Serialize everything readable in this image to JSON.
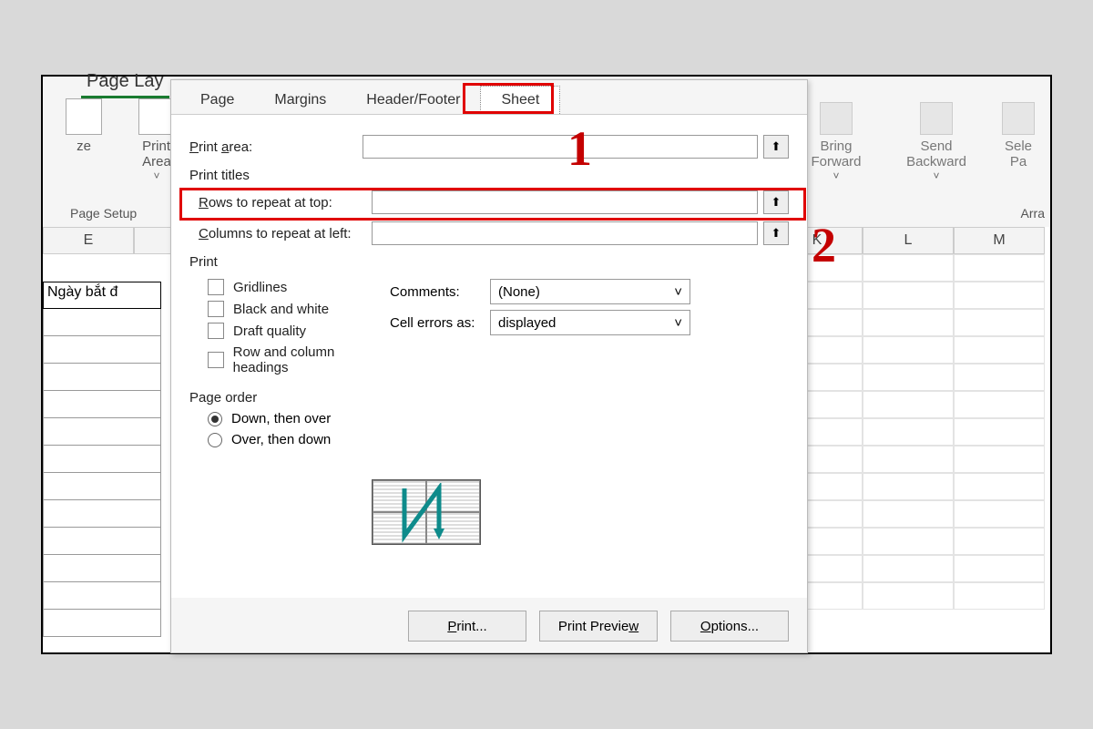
{
  "ribbon": {
    "tab_pagelayout": "Page Lay",
    "btn_size": "ze",
    "btn_printarea": "Print\nArea",
    "caret": "˅",
    "group_pagesetup": "Page Setup",
    "bring_forward": "Bring\nForward",
    "send_backward": "Send\nBackward",
    "selection": "Sele\nPa",
    "group_arrange": "Arra"
  },
  "sheet": {
    "cols": [
      "E",
      "",
      "",
      "",
      "",
      "",
      "K",
      "L",
      "M"
    ],
    "ngay": "Ngày bắt đ"
  },
  "dialog": {
    "tabs": {
      "page": "Page",
      "margins": "Margins",
      "hf": "Header/Footer",
      "sheet": "Sheet"
    },
    "print_area_lbl": "Print area:",
    "section_titles": "Print titles",
    "rows_repeat": "Rows to repeat at top:",
    "cols_repeat": "Columns to repeat at left:",
    "section_print": "Print",
    "chk_gridlines": "Gridlines",
    "chk_bw": "Black and white",
    "chk_draft": "Draft quality",
    "chk_rc": "Row and column headings",
    "comments_lbl": "Comments:",
    "comments_val": "(None)",
    "cellerr_lbl": "Cell errors as:",
    "cellerr_val": "displayed",
    "section_order": "Page order",
    "radio_down": "Down, then over",
    "radio_over": "Over, then down",
    "btn_print": "Print...",
    "btn_preview": "Print Preview",
    "btn_options": "Options...",
    "refglyph": "⬆"
  },
  "annot": {
    "one": "1",
    "two": "2"
  }
}
